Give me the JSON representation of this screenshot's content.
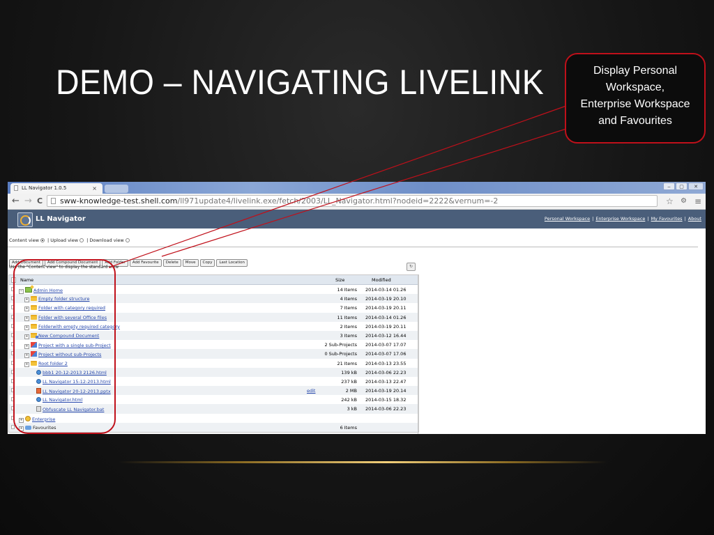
{
  "slide": {
    "title": "DEMO – NAVIGATING LIVELINK",
    "callout_lines": [
      "Display Personal",
      "Workspace,",
      "Enterprise Workspace",
      "and Favourites"
    ],
    "accent_color": "#c0101a"
  },
  "browser": {
    "tab_title": "LL Navigator 1.0.5",
    "tab_close": "×",
    "window_controls": [
      "‒",
      "▢",
      "✕"
    ],
    "back_label": "←",
    "forward_label": "→",
    "reload_label": "C",
    "url_host": "sww-knowledge-test.shell.com",
    "url_path": "/ll971update4/livelink.exe/fetch/2003/LL_Navigator.html?nodeid=2222&vernum=-2",
    "bookmark_icon": "☆",
    "extension_icon": "⚙",
    "menu_icon": "≡"
  },
  "app": {
    "title": "LL Navigator",
    "header_links": [
      "Personal Workspace",
      "Enterprise Workspace",
      "My Favourites",
      "About"
    ],
    "views": [
      {
        "label": "Content view",
        "selected": true
      },
      {
        "label": "| Upload view",
        "selected": false
      },
      {
        "label": "| Download view",
        "selected": false
      }
    ],
    "actions": [
      "Add Document",
      "Add Compound Document",
      "Add Folder",
      "Add Favourite",
      "Delete",
      "Move",
      "Copy",
      "Last Location"
    ],
    "hint": "Use the \"Content view\" to display the standard view",
    "refresh_icon": "↻",
    "columns": {
      "name": "Name",
      "size": "Size",
      "modified": "Modified"
    },
    "rows": [
      {
        "indent": 1,
        "expander": "−",
        "icon": "home",
        "name": "Admin Home",
        "link": true,
        "size": "14 Items",
        "modified": "2014-03-14 01.26",
        "edit": ""
      },
      {
        "indent": 2,
        "expander": "+",
        "icon": "folder",
        "name": "Empty folder structure",
        "link": true,
        "size": "4 Items",
        "modified": "2014-03-19 20.10",
        "edit": ""
      },
      {
        "indent": 2,
        "expander": "+",
        "icon": "folder",
        "name": "Folder with category required",
        "link": true,
        "size": "7 Items",
        "modified": "2014-03-19 20.11",
        "edit": ""
      },
      {
        "indent": 2,
        "expander": "+",
        "icon": "folder",
        "name": "Folder with several Office files",
        "link": true,
        "size": "11 Items",
        "modified": "2014-03-14 01.26",
        "edit": ""
      },
      {
        "indent": 2,
        "expander": "+",
        "icon": "folder",
        "name": "Folderwith empty required category",
        "link": true,
        "size": "2 Items",
        "modified": "2014-03-19 20.11",
        "edit": ""
      },
      {
        "indent": 2,
        "expander": "+",
        "icon": "folderp",
        "name": "New Compound Document",
        "link": true,
        "size": "3 Items",
        "modified": "2014-03-12 16.44",
        "edit": ""
      },
      {
        "indent": 2,
        "expander": "+",
        "icon": "proj",
        "name": "Project with a single sub-Project",
        "link": true,
        "size": "2 Sub-Projects",
        "modified": "2014-03-07 17.07",
        "edit": ""
      },
      {
        "indent": 2,
        "expander": "+",
        "icon": "proj",
        "name": "Project without sub-Projects",
        "link": true,
        "size": "0 Sub-Projects",
        "modified": "2014-03-07 17.06",
        "edit": ""
      },
      {
        "indent": 2,
        "expander": "+",
        "icon": "folder",
        "name": "Root folder 2",
        "link": true,
        "size": "21 Items",
        "modified": "2014-03-13 23.55",
        "edit": ""
      },
      {
        "indent": 3,
        "expander": "",
        "icon": "html",
        "name": "bbb1 20-12-2013 2126.html",
        "link": true,
        "size": "139 kB",
        "modified": "2014-03-06 22.23",
        "edit": ""
      },
      {
        "indent": 3,
        "expander": "",
        "icon": "html",
        "name": "LL Navigator 15-12-2013.html",
        "link": true,
        "size": "237 kB",
        "modified": "2014-03-13 22.47",
        "edit": ""
      },
      {
        "indent": 3,
        "expander": "",
        "icon": "ppt",
        "name": "LL Navigator 20-12-2013.pptx",
        "link": true,
        "size": "2 MB",
        "modified": "2014-03-19 20.14",
        "edit": "edit"
      },
      {
        "indent": 3,
        "expander": "",
        "icon": "html",
        "name": "LL Navigator.html",
        "link": true,
        "size": "242 kB",
        "modified": "2014-03-15 18.32",
        "edit": ""
      },
      {
        "indent": 3,
        "expander": "",
        "icon": "bat",
        "name": "Obfuscate LL Navigator.bat",
        "link": true,
        "size": "3 kB",
        "modified": "2014-03-06 22.23",
        "edit": ""
      },
      {
        "indent": 1,
        "expander": "+",
        "icon": "ent",
        "name": "Enterprise",
        "link": true,
        "size": "",
        "modified": "",
        "edit": ""
      },
      {
        "indent": 1,
        "expander": "+",
        "icon": "fav",
        "name": "Favourites",
        "link": false,
        "size": "6 Items",
        "modified": "",
        "edit": ""
      }
    ]
  }
}
